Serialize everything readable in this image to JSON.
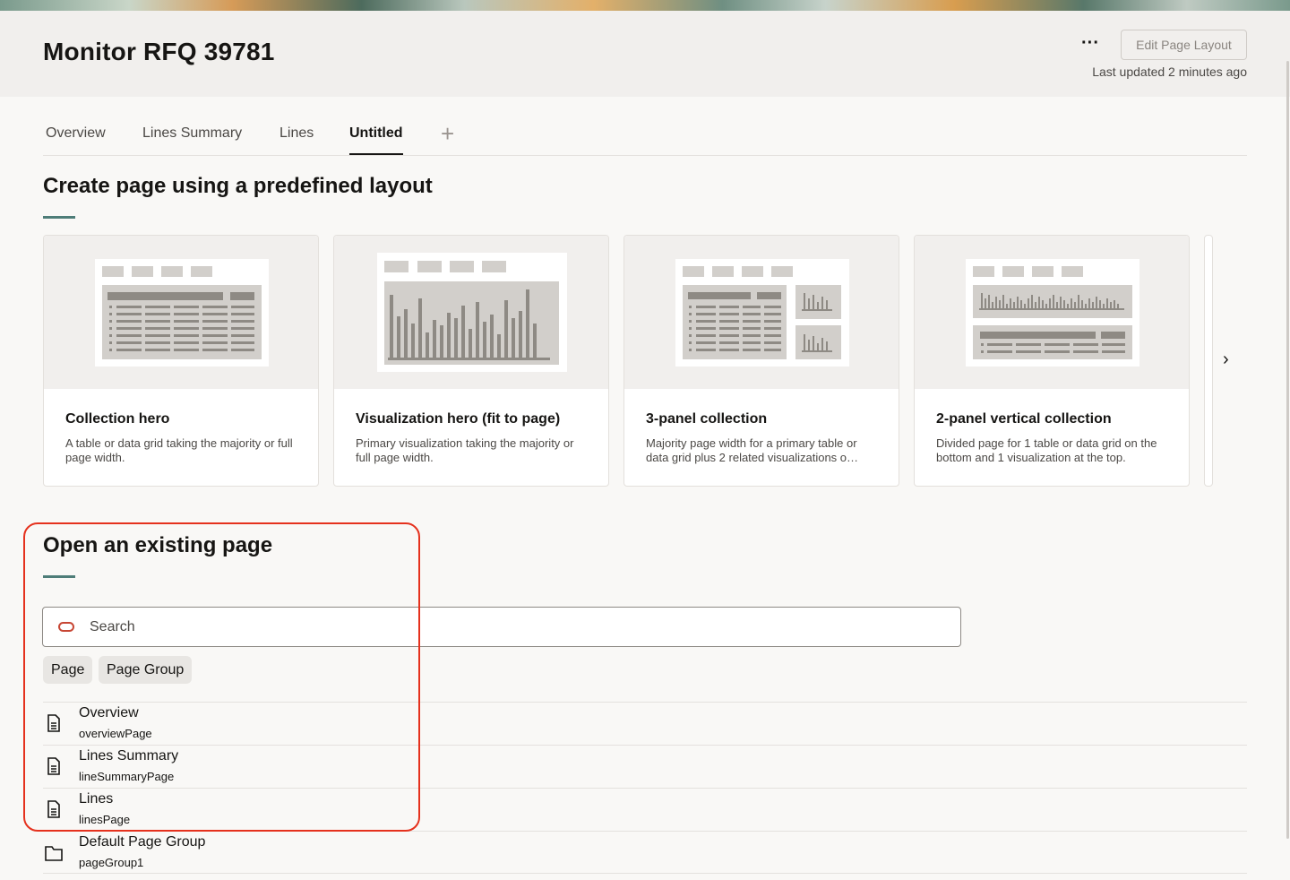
{
  "header": {
    "title": "Monitor RFQ 39781",
    "more_label": "···",
    "edit_button": "Edit Page Layout",
    "last_updated": "Last updated 2 minutes ago"
  },
  "tabs": [
    {
      "label": "Overview"
    },
    {
      "label": "Lines Summary"
    },
    {
      "label": "Lines"
    },
    {
      "label": "Untitled",
      "active": true
    }
  ],
  "tab_add": "+",
  "layouts_section": {
    "title": "Create page using a predefined layout",
    "cards": [
      {
        "title": "Collection hero",
        "desc": "A table or data grid taking the majority or full page width."
      },
      {
        "title": "Visualization hero (fit to page)",
        "desc": "Primary visualization taking the majority or full page width."
      },
      {
        "title": "3-panel collection",
        "desc": "Majority page width for a primary table or data grid plus 2 related visualizations o…"
      },
      {
        "title": "2-panel vertical collection",
        "desc": "Divided page for 1 table or data grid on the bottom and 1 visualization at the top."
      }
    ],
    "next_icon": "›"
  },
  "existing_section": {
    "title": "Open an existing page",
    "search_placeholder": "Search",
    "chips": [
      "Page",
      "Page Group"
    ],
    "items": [
      {
        "name": "Overview",
        "id": "overviewPage",
        "icon": "document-icon"
      },
      {
        "name": "Lines Summary",
        "id": "lineSummaryPage",
        "icon": "document-icon"
      },
      {
        "name": "Lines",
        "id": "linesPage",
        "icon": "document-icon"
      },
      {
        "name": "Default Page Group",
        "id": "pageGroup1",
        "icon": "folder-icon"
      }
    ]
  },
  "colors": {
    "accent_rule": "#4e7d78",
    "highlight": "#e5311d",
    "search_icon": "#c74634"
  }
}
